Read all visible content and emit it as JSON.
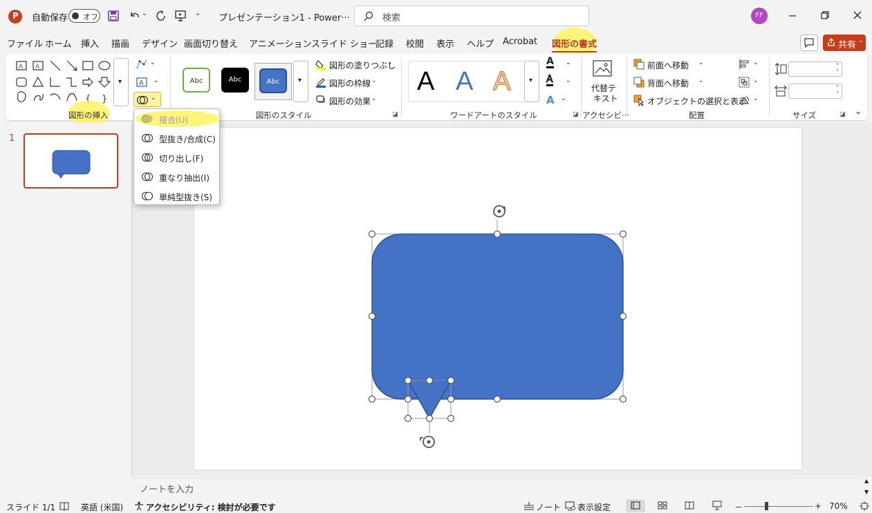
{
  "titlebar": {
    "autosave_label": "自動保存",
    "autosave_state": "オフ",
    "doc_title": "プレゼンテーション1  -  Power···",
    "search_placeholder": "検索",
    "avatar_initials": "FF"
  },
  "menu": {
    "tabs": [
      "ファイル",
      "ホーム",
      "挿入",
      "描画",
      "デザイン",
      "画面切り替え",
      "アニメーション",
      "スライド ショー",
      "記録",
      "校閲",
      "表示",
      "ヘルプ",
      "Acrobat"
    ],
    "active_tab": "図形の書式",
    "share_label": "共有"
  },
  "ribbon": {
    "groups": {
      "insert_shapes": "図形の挿入",
      "shape_styles": "図形のスタイル",
      "wordart_styles": "ワードアートのスタイル",
      "accessibility": "アクセシビ···",
      "arrange": "配置",
      "size": "サイズ"
    },
    "style_samples": [
      "Abc",
      "Abc",
      "Abc"
    ],
    "shape_fill": "図形の塗りつぶし",
    "shape_outline": "図形の枠線",
    "shape_effects": "図形の効果",
    "wordart_letters": [
      "A",
      "A",
      "A"
    ],
    "small_a": [
      "A",
      "A",
      "A"
    ],
    "alt_text_line1": "代替テ",
    "alt_text_line2": "キスト",
    "bring_forward": "前面へ移動",
    "send_backward": "背面へ移動",
    "selection_pane": "オブジェクトの選択と表示"
  },
  "merge_menu": {
    "items": [
      "接合(U)",
      "型抜き/合成(C)",
      "切り出し(F)",
      "重なり抽出(I)",
      "単純型抜き(S)"
    ]
  },
  "slides": {
    "number": "1"
  },
  "notes": {
    "placeholder": "ノートを入力"
  },
  "status": {
    "slide_count": "スライド 1/1",
    "language": "英語 (米国)",
    "accessibility": "アクセシビリティ: 検討が必要です",
    "notes_btn": "ノート",
    "display_settings": "表示設定",
    "zoom": "70%",
    "zoom_minus": "－",
    "zoom_plus": "+"
  },
  "colors": {
    "shape_fill": "#4472c4",
    "accent": "#c43e1c",
    "highlight": "#fff462",
    "avatar": "#b146c2"
  }
}
